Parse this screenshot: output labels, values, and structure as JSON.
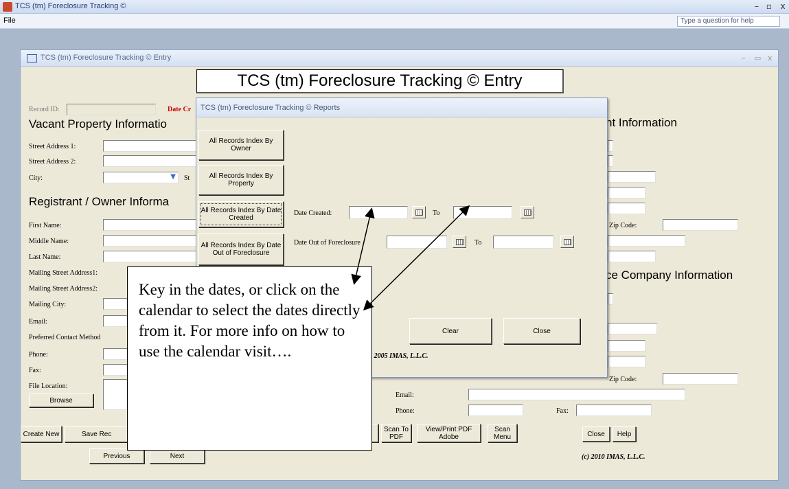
{
  "window": {
    "title": "TCS (tm) Foreclosure Tracking ©",
    "menu_file": "File",
    "help_placeholder": "Type a question for help"
  },
  "entry": {
    "title": "TCS (tm) Foreclosure Tracking ©  Entry",
    "heading": "TCS (tm) Foreclosure Tracking ©  Entry",
    "record_id_label": "Record ID:",
    "date_created_partial": "Date Cr",
    "vacant_section": "Vacant Property Informatio",
    "street1": "Street Address 1:",
    "street2": "Street Address 2:",
    "city": "City:",
    "state_partial": "St",
    "registrant_section": "Registrant / Owner Informa",
    "first_name": "First Name:",
    "middle_name": "Middle Name:",
    "last_name": "Last Name:",
    "mailing1": "Mailing Street Address1:",
    "mailing2": "Mailing Street Address2:",
    "mailing_city": "Mailing City:",
    "email": "Email:",
    "preferred_contact": "Preferred Contact Method",
    "phone": "Phone:",
    "fax": "Fax:",
    "file_location": "File Location:",
    "browse": "Browse",
    "agent_section_partial": "nt Information",
    "company_section_partial": "ce Company Information",
    "zip_code": "Zip Code:",
    "zip_code2": "Zip Code:",
    "email_right": "Email:",
    "phone_right": "Phone:",
    "fax_right": "Fax:",
    "buttons": {
      "create_new": "Create New",
      "save_rec": "Save Rec",
      "scan_to_pdf": "Scan To PDF",
      "view_print_pdf": "View/Print PDF Adobe",
      "scan_menu": "Scan Menu",
      "close": "Close",
      "help": "Help",
      "previous": "Previous",
      "next": "Next"
    },
    "copyright": "(c) 2010 IMAS, L.L.C."
  },
  "reports": {
    "title": "TCS (tm) Foreclosure Tracking ©  Reports",
    "btn_owner": "All Records Index By Owner",
    "btn_property": "All Records Index By Property",
    "btn_date_created": "All Records Index By Date Created",
    "btn_date_out": "All Records Index By Date Out of Foreclosure",
    "date_created_label": "Date Created:",
    "to1": "To",
    "date_out_label": "Date Out of Foreclosure",
    "to2": "To",
    "clear": "Clear",
    "close": "Close",
    "copyright": "(c) 2005 IMAS, L.L.C."
  },
  "callout": {
    "text": "Key in the dates, or click on the calendar to select the dates directly from it. For more info on how to use the calendar visit…."
  }
}
